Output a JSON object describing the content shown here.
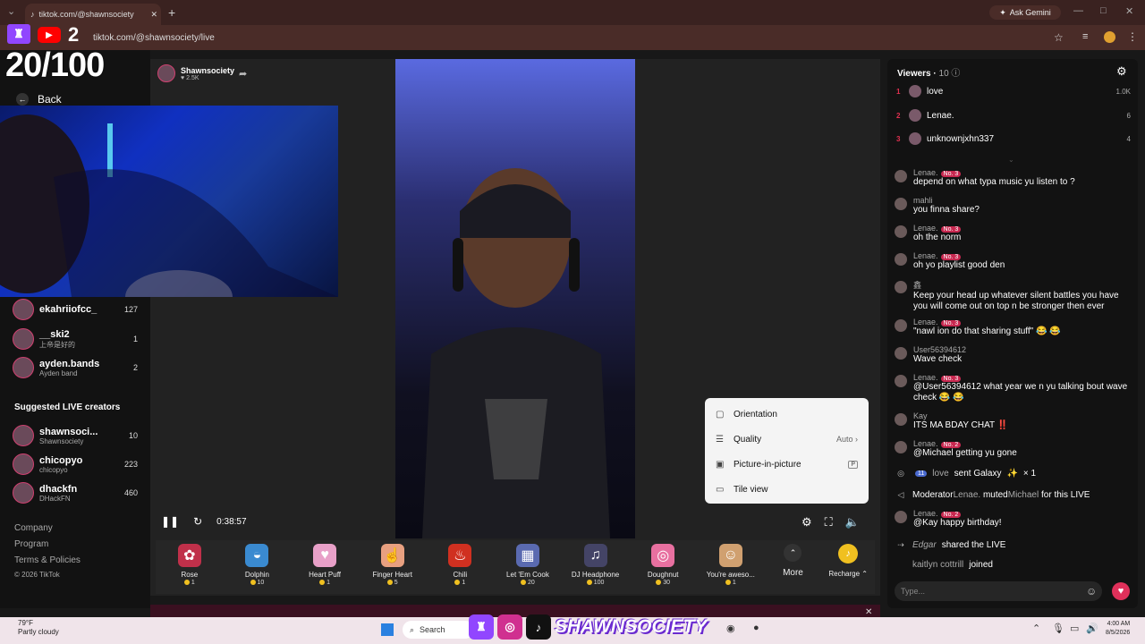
{
  "browser": {
    "tab_title": "tiktok.com/@shawnsociety",
    "url": "tiktok.com/@shawnsociety/live",
    "gemini_label": "Ask Gemini"
  },
  "overlay": {
    "number": "2",
    "counter": "20/100"
  },
  "sidebar": {
    "back_label": "Back",
    "following": [
      {
        "name": "ekahriiofcc_",
        "sub": "",
        "count": "127"
      },
      {
        "name": "__ski2",
        "sub": "上帝是好的",
        "count": "1"
      },
      {
        "name": "ayden.bands",
        "sub": "Ayden band",
        "count": "2"
      }
    ],
    "suggested_heading": "Suggested LIVE creators",
    "suggested": [
      {
        "name": "shawnsoci...",
        "sub": "Shawnsociety",
        "count": "10"
      },
      {
        "name": "chicopyo",
        "sub": "chicopyo",
        "count": "223"
      },
      {
        "name": "dhackfn",
        "sub": "DHackFN",
        "count": "460"
      }
    ],
    "footer": [
      "Company",
      "Program",
      "Terms & Policies",
      "© 2026 TikTok"
    ]
  },
  "host": {
    "name": "Shawnsociety",
    "likes": "2.5K"
  },
  "player": {
    "time": "0:38:57"
  },
  "settings_menu": {
    "items": [
      {
        "label": "Orientation",
        "value": ""
      },
      {
        "label": "Quality",
        "value": "Auto"
      },
      {
        "label": "Picture-in-picture",
        "value": "P"
      },
      {
        "label": "Tile view",
        "value": ""
      }
    ]
  },
  "gifts": [
    {
      "name": "Rose",
      "price": "1",
      "color": "#c0304a"
    },
    {
      "name": "Dolphin",
      "price": "10",
      "color": "#3a8ad0"
    },
    {
      "name": "Heart Puff",
      "price": "1",
      "color": "#e8a0c8"
    },
    {
      "name": "Finger Heart",
      "price": "5",
      "color": "#e8a080"
    },
    {
      "name": "Chili",
      "price": "1",
      "color": "#d03020"
    },
    {
      "name": "Let 'Em Cook",
      "price": "20",
      "color": "#5a6ab0"
    },
    {
      "name": "DJ Headphone",
      "price": "100",
      "color": "#444466"
    },
    {
      "name": "Doughnut",
      "price": "30",
      "color": "#e870a0"
    },
    {
      "name": "You're aweso...",
      "price": "1",
      "color": "#d0a070"
    }
  ],
  "gift_more": "More",
  "gift_recharge": "Recharge",
  "viewers": {
    "heading": "Viewers",
    "count": "10",
    "top": [
      {
        "rank": "1",
        "name": "love",
        "score": "1.0K"
      },
      {
        "rank": "2",
        "name": "Lenae.",
        "score": "6"
      },
      {
        "rank": "3",
        "name": "unknownjxhn337",
        "score": "4"
      }
    ]
  },
  "chat": [
    {
      "user": "Lenae.",
      "badge": "No. 3",
      "text": "depend on what typa music yu listen to ?"
    },
    {
      "user": "mahli",
      "badge": "",
      "text": "you finna share?"
    },
    {
      "user": "Lenae.",
      "badge": "No. 3",
      "text": "oh the norm"
    },
    {
      "user": "Lenae.",
      "badge": "No. 3",
      "text": "oh yo playlist good den"
    },
    {
      "user": "鑫",
      "badge": "",
      "text": "Keep your head up whatever silent battles you have you will come out on top n be stronger then ever"
    },
    {
      "user": "Lenae.",
      "badge": "No. 3",
      "text": "\"nawl ion do that sharing stuff\" 😂 😂"
    },
    {
      "user": "User56394612",
      "badge": "",
      "text": "Wave check"
    },
    {
      "user": "Lenae.",
      "badge": "No. 3",
      "text": "@User56394612 what year we n yu talking bout wave check 😂 😂"
    },
    {
      "user": "Kay",
      "badge": "",
      "text": "ITS MA BDAY CHAT ‼️"
    },
    {
      "user": "Lenae.",
      "badge": "No. 2",
      "text": "@Michael getting yu gone"
    },
    {
      "user": "Lenae.",
      "badge": "No. 2",
      "text": "@Kay happy birthday!"
    }
  ],
  "system": {
    "gift_level": "11",
    "gift_user": "love",
    "gift_text": "sent Galaxy",
    "gift_count": "× 1",
    "mod_role": "Moderator",
    "mod_user": "Lenae.",
    "mod_text": "muted",
    "mod_target": "Michael",
    "mod_suffix": "for this LIVE",
    "share_user": "Edgar",
    "share_text": "shared the LIVE",
    "join_user": "kaitlyn cottrill",
    "join_text": "joined"
  },
  "chat_input_placeholder": "Type...",
  "taskbar": {
    "temp": "79°F",
    "weather": "Partly cloudy",
    "search": "Search",
    "brand": "SHAWNSOCIETY",
    "time": "4:00 AM",
    "date": "8/5/2026"
  },
  "colors": {
    "accent": "#e0305a",
    "twitch": "#9146ff",
    "badge": "#c82850"
  }
}
